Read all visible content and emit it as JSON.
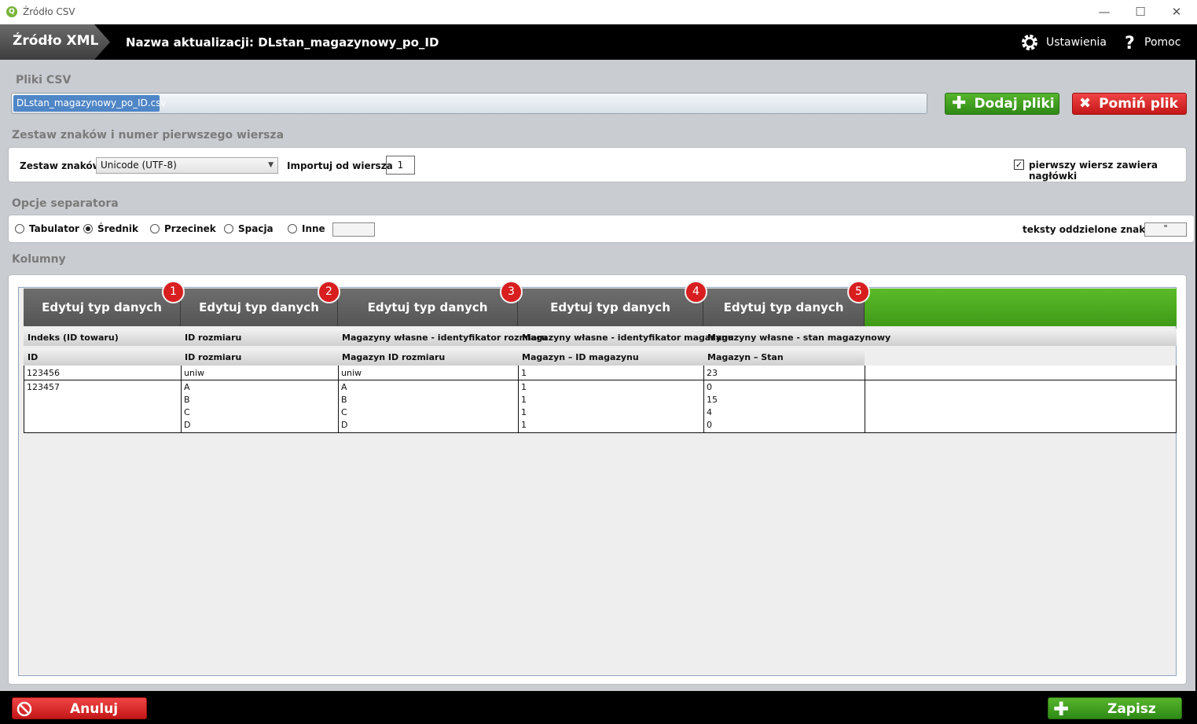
{
  "window": {
    "title": "Źródło CSV",
    "app_icon_letter": "Q",
    "minimize": "—",
    "maximize": "☐",
    "close": "✕"
  },
  "header": {
    "breadcrumb": "Źródło XML",
    "update_name": "Nazwa aktualizacji: DLstan_magazynowy_po_ID",
    "settings_label": "Ustawienia",
    "help_label": "Pomoc"
  },
  "csv_files": {
    "section_title": "Pliki CSV",
    "selected_file": "DLstan_magazynowy_po_ID.csv",
    "add_label": "Dodaj pliki",
    "skip_label": "Pomiń plik"
  },
  "charset": {
    "section_title": "Zestaw znaków i numer pierwszego wiersza",
    "charset_label": "Zestaw znaków",
    "charset_value": "Unicode (UTF-8)",
    "import_label": "Importuj od wiersza",
    "import_value": "1",
    "header_row_label": "pierwszy wiersz zawiera nagłówki",
    "header_row_checked": true
  },
  "separator": {
    "section_title": "Opcje separatora",
    "options": [
      "Tabulator",
      "Średnik",
      "Przecinek",
      "Spacja",
      "Inne"
    ],
    "selected": "Średnik",
    "other_value": "",
    "text_qualifier_label": "teksty oddzielone znakiem",
    "text_qualifier_value": "\""
  },
  "columns": {
    "section_title": "Kolumny",
    "edit_label": "Edytuj typ danych",
    "numbers": [
      "1",
      "2",
      "3",
      "4",
      "5"
    ],
    "target_fields": [
      "Indeks (ID towaru)",
      "ID rozmiaru",
      "Magazyny własne - identyfikator rozmiaru",
      "Magazyny własne - identyfikator magazynu",
      "Magazyny własne - stan magazynowy"
    ],
    "source_headers": [
      "ID",
      "ID rozmiaru",
      "Magazyn ID rozmiaru",
      "Magazyn – ID magazynu",
      "Magazyn – Stan"
    ],
    "rows": [
      [
        "123456",
        "uniw",
        "uniw",
        "1",
        "23"
      ],
      [
        "123457",
        "A",
        "A",
        "1",
        "0"
      ],
      [
        "",
        "B",
        "B",
        "1",
        "15"
      ],
      [
        "",
        "C",
        "C",
        "1",
        "4"
      ],
      [
        "",
        "D",
        "D",
        "1",
        "0"
      ]
    ]
  },
  "footer": {
    "cancel_label": "Anuluj",
    "save_label": "Zapisz"
  },
  "colors": {
    "accent_green": "#3f9a17",
    "accent_red": "#d81e1e",
    "selection_blue": "#4f86c6",
    "header_black": "#000000"
  }
}
